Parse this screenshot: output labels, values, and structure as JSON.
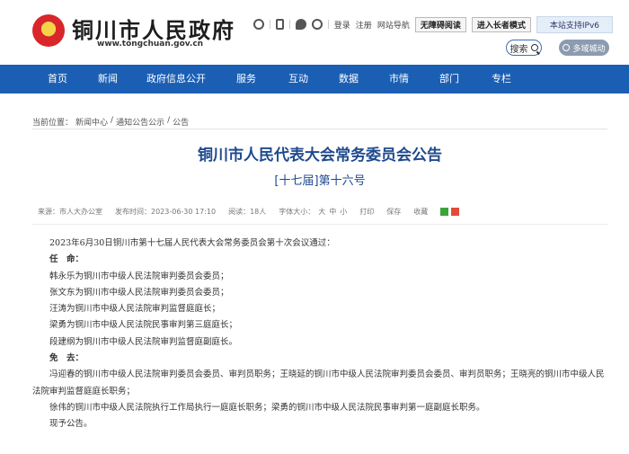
{
  "header": {
    "site_title": "铜川市人民政府",
    "site_url": "www.tongchuan.gov.cn",
    "top_links": {
      "login": "登录",
      "register": "注册",
      "site_nav": "网站导航",
      "accessible": "无障碍阅读",
      "elder_mode": "进入长者模式",
      "ipv6": "本站支持IPv6"
    },
    "search_label": "搜索",
    "lang_label": "多域城动"
  },
  "nav": {
    "items": [
      "首页",
      "新闻",
      "政府信息公开",
      "服务",
      "互动",
      "数据",
      "市情",
      "部门",
      "专栏"
    ]
  },
  "breadcrumb": {
    "prefix": "当前位置：",
    "items": [
      "新闻中心",
      "通知公告公示",
      "公告"
    ],
    "sep": "/"
  },
  "article": {
    "title": "铜川市人民代表大会常务委员会公告",
    "subtitle": "[十七届]第十六号",
    "meta": {
      "source": "来源：市人大办公室",
      "published": "发布时间：2023-06-30 17:10",
      "views": "阅读：18人",
      "font_size_label": "字体大小：",
      "font_large": "大",
      "font_medium": "中",
      "font_small": "小",
      "print": "打印",
      "save": "保存",
      "favorite": "收藏"
    },
    "paragraphs": [
      {
        "text": "2023年6月30日铜川市第十七届人民代表大会常务委员会第十次会议通过：",
        "bold": false
      },
      {
        "text": "任　命：",
        "bold": true
      },
      {
        "text": "韩永乐为铜川市中级人民法院审判委员会委员；",
        "bold": false
      },
      {
        "text": "张文东为铜川市中级人民法院审判委员会委员；",
        "bold": false
      },
      {
        "text": "汪涛为铜川市中级人民法院审判监督庭庭长；",
        "bold": false
      },
      {
        "text": "梁勇为铜川市中级人民法院民事审判第三庭庭长；",
        "bold": false
      },
      {
        "text": "段建纲为铜川市中级人民法院审判监督庭副庭长。",
        "bold": false
      },
      {
        "text": "免　去：",
        "bold": true
      },
      {
        "text": "冯迎春的铜川市中级人民法院审判委员会委员、审判员职务；王晓延的铜川市中级人民法院审判委员会委员、审判员职务；王晓亮的铜川市中级人民法院审判监督庭庭长职务；",
        "bold": false
      },
      {
        "text": "徐伟的铜川市中级人民法院执行工作局执行一庭庭长职务；梁勇的铜川市中级人民法院民事审判第一庭副庭长职务。",
        "bold": false
      },
      {
        "text": "现予公告。",
        "bold": false
      }
    ]
  }
}
